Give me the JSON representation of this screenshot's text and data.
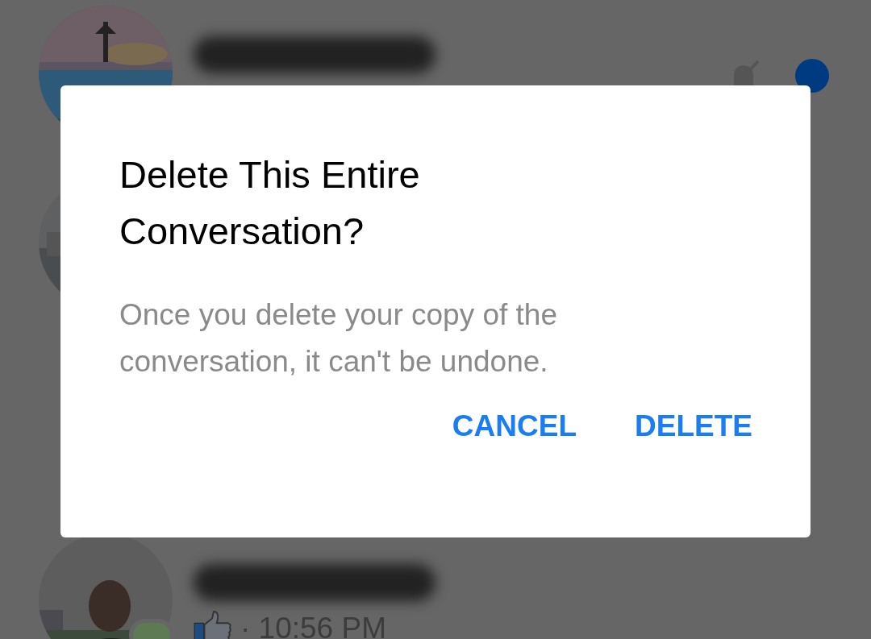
{
  "conversations": [
    {
      "muted": true,
      "unread": true,
      "online": false
    },
    {
      "muted": false,
      "unread": false,
      "online": false
    },
    {
      "muted": false,
      "unread": false,
      "online": true,
      "time": "· 10:56 PM"
    }
  ],
  "dialog": {
    "title": "Delete This Entire Conversation?",
    "message": "Once you delete your copy of the conversation, it can't be undone.",
    "buttons": [
      {
        "label": "CANCEL"
      },
      {
        "label": "DELETE"
      }
    ]
  }
}
